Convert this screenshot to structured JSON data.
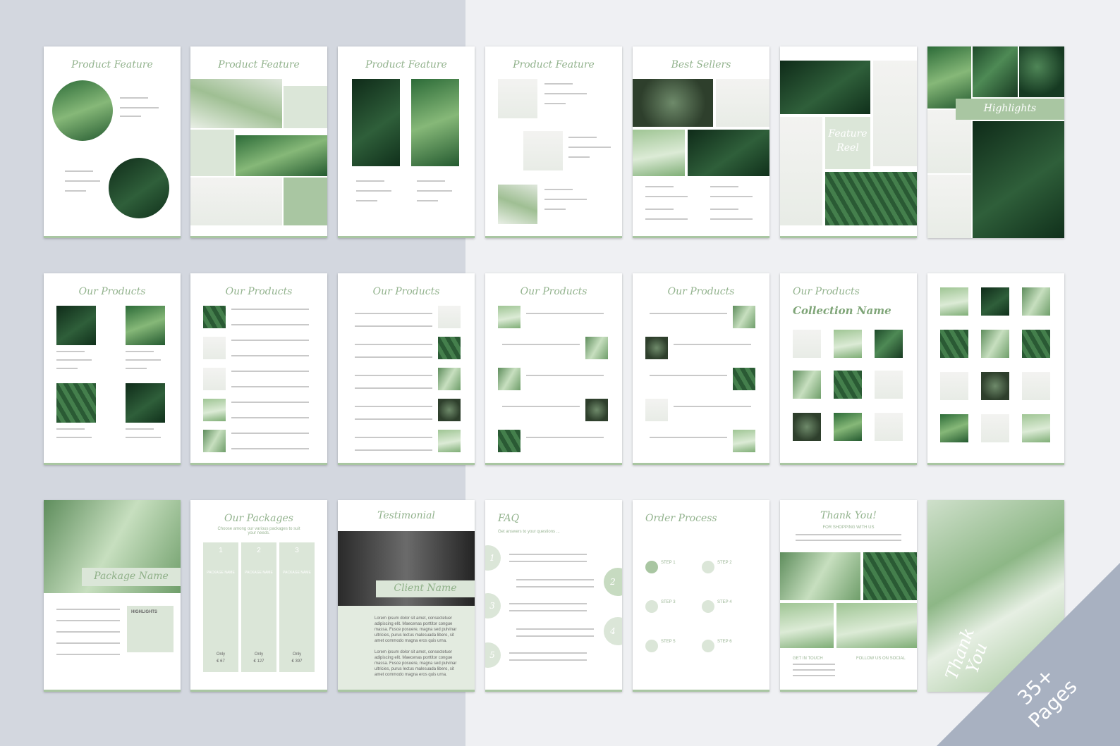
{
  "badge": {
    "line1": "35+",
    "line2": "Pages"
  },
  "row1": {
    "p1_title": "Product Feature",
    "p2_title": "Product Feature",
    "p3_title": "Product Feature",
    "p4_title": "Product Feature",
    "p5_title": "Best Sellers",
    "p6_tag": "Feature Reel",
    "p7_tag": "Highlights"
  },
  "row2": {
    "p1_title": "Our Products",
    "p2_title": "Our Products",
    "p3_title": "Our Products",
    "p4_title": "Our Products",
    "p5_title": "Our Products",
    "p6_title": "Our Products",
    "p6_sub": "Collection Name"
  },
  "row3": {
    "package_name": "Package Name",
    "highlights_label": "HIGHLIGHTS",
    "packages_title": "Our Packages",
    "packages_sub": "Choose among our various packages to suit your needs.",
    "pkg_nums": [
      "1",
      "2",
      "3"
    ],
    "pkg_name": "PACKAGE NAME",
    "pkg_price_label": "Only",
    "pkg_prices": [
      "€ 67",
      "€ 127",
      "€ 397"
    ],
    "testimonial_title": "Testimonial",
    "client_name": "Client Name",
    "testimonial_text": "Lorem ipsum dolor sit amet, consectetuer adipiscing elit. Maecenas porttitor congue massa. Fusce posuere, magna sed pulvinar ultricies, purus lectus malesuada libero, sit amet commodo magna eros quis urna.",
    "testimonial_text2": "Lorem ipsum dolor sit amet, consectetuer adipiscing elit. Maecenas porttitor congue massa. Fusce posuere, magna sed pulvinar ultricies, purus lectus malesuada libero, sit amet commodo magna eros quis urna.",
    "faq_title": "FAQ",
    "faq_sub": "Get answers to your questions ...",
    "faq_nums": [
      "1",
      "2",
      "3",
      "4",
      "5"
    ],
    "order_title": "Order Process",
    "steps": [
      "STEP 1",
      "STEP 2",
      "STEP 3",
      "STEP 4",
      "STEP 5",
      "STEP 6"
    ],
    "thanks_title": "Thank You!",
    "thanks_sub": "FOR SHOPPING WITH US",
    "get_in_touch": "GET IN TOUCH",
    "follow_us": "FOLLOW US ON SOCIAL",
    "cover_thank": "Thank",
    "cover_you": "You"
  }
}
